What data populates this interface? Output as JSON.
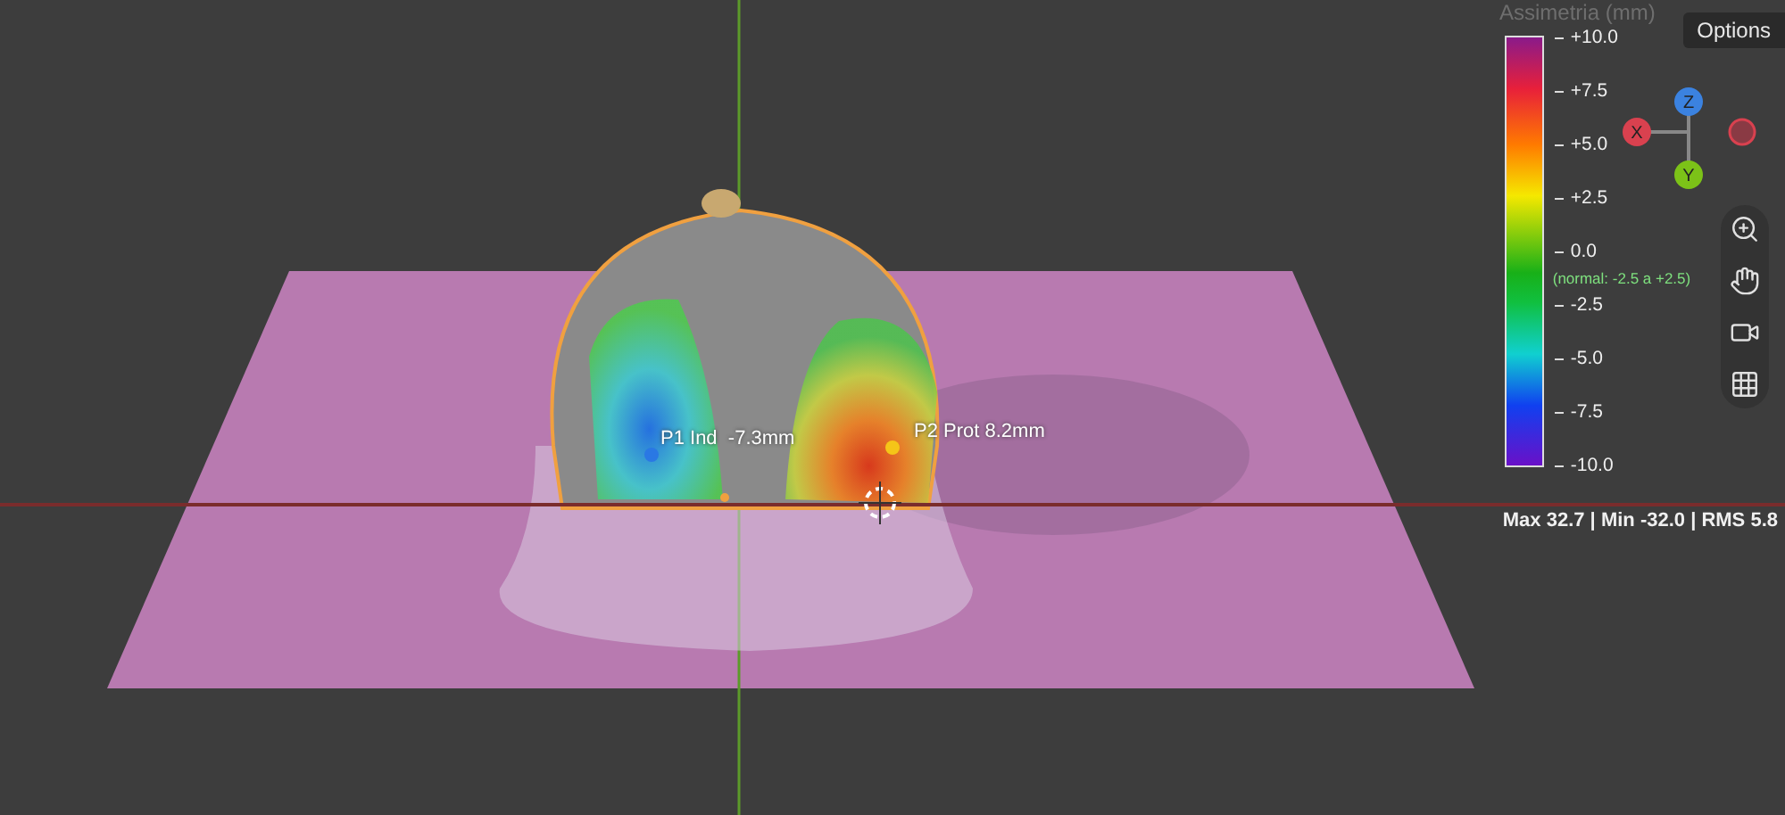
{
  "legend": {
    "title": "Assimetria (mm)",
    "ticks": [
      "+10.0",
      "+7.5",
      "+5.0",
      "+2.5",
      "0.0",
      "-2.5",
      "-5.0",
      "-7.5",
      "-10.0"
    ],
    "note": "(normal: -2.5 a +2.5)"
  },
  "options_button": "Options",
  "gizmo": {
    "axes": [
      {
        "label": "Z",
        "color": "#3b82e0"
      },
      {
        "label": "X",
        "color": "#d9414f"
      },
      {
        "label": "Y",
        "color": "#7cc218"
      }
    ]
  },
  "points": [
    {
      "label": "P1 Ind  -7.3mm",
      "color": "#2a78e4"
    },
    {
      "label": "P2 Prot 8.2mm",
      "color": "#f5c518"
    }
  ],
  "stats": "Max 32.7 | Min -32.0 | RMS 5.8"
}
